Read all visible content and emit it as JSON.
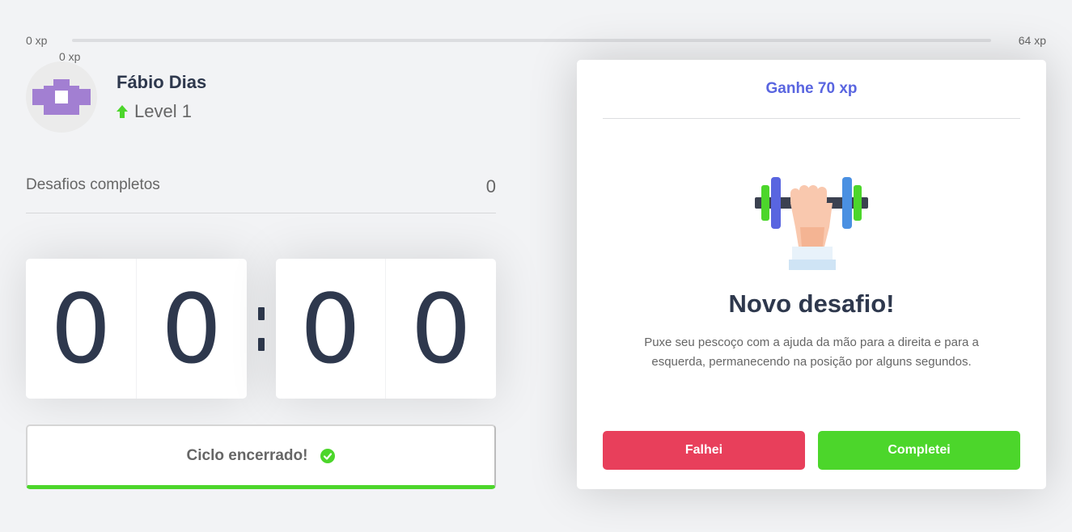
{
  "xp": {
    "min_label": "0 xp",
    "max_label": "64 xp",
    "current_label": "0 xp",
    "progress_fraction": 0.0
  },
  "profile": {
    "name": "Fábio Dias",
    "level_label": "Level 1",
    "level_icon": "arrow-up-icon"
  },
  "stats": {
    "completed_label": "Desafios completos",
    "completed_count": "0"
  },
  "countdown": {
    "minute_left": "0",
    "minute_right": "0",
    "second_left": "0",
    "second_right": "0"
  },
  "cycle": {
    "label": "Ciclo encerrado!",
    "icon": "check-circle-icon"
  },
  "challenge": {
    "header": "Ganhe 70 xp",
    "illustration": "dumbbell-icon",
    "title": "Novo desafio!",
    "description": "Puxe seu pescoço com a ajuda da mão para a direita e para a esquerda, permanecendo na posição por alguns segundos.",
    "fail_label": "Falhei",
    "complete_label": "Completei"
  },
  "colors": {
    "green": "#4cd62b",
    "red": "#e83f5b",
    "blue": "#5965e0",
    "title": "#2e384d",
    "text": "#666666",
    "background": "#f2f3f5"
  }
}
